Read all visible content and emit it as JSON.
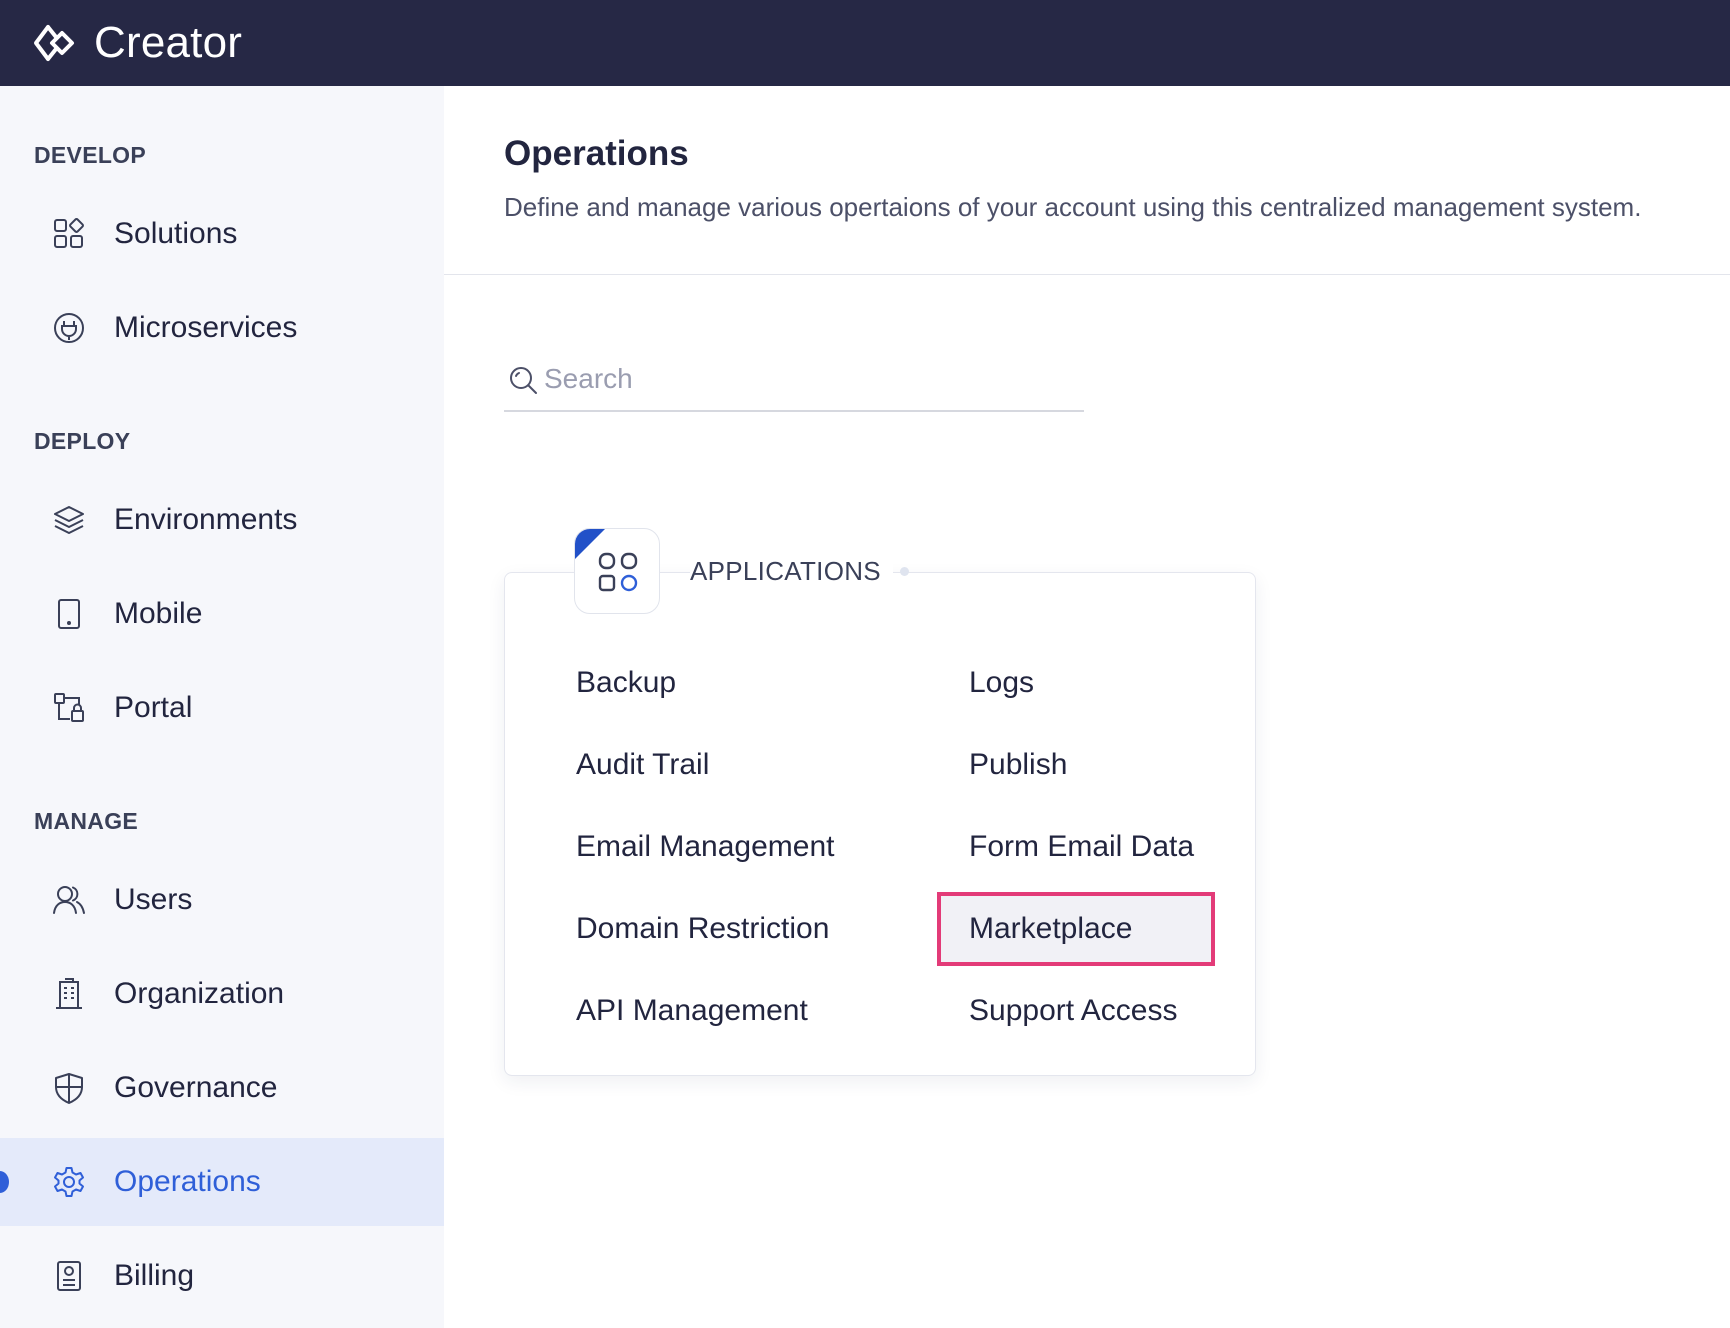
{
  "app": {
    "name": "Creator"
  },
  "sidebar": {
    "sections": [
      {
        "title": "DEVELOP"
      },
      {
        "title": "DEPLOY"
      },
      {
        "title": "MANAGE"
      }
    ],
    "items": [
      {
        "label": "Solutions",
        "icon": "solutions-icon"
      },
      {
        "label": "Microservices",
        "icon": "microservices-icon"
      },
      {
        "label": "Environments",
        "icon": "layers-icon"
      },
      {
        "label": "Mobile",
        "icon": "mobile-icon"
      },
      {
        "label": "Portal",
        "icon": "portal-icon"
      },
      {
        "label": "Users",
        "icon": "users-icon"
      },
      {
        "label": "Organization",
        "icon": "building-icon"
      },
      {
        "label": "Governance",
        "icon": "shield-icon"
      },
      {
        "label": "Operations",
        "icon": "gear-icon",
        "active": true
      },
      {
        "label": "Billing",
        "icon": "billing-icon"
      }
    ]
  },
  "main": {
    "title": "Operations",
    "description": "Define and manage various opertaions of your account using this centralized management system.",
    "search": {
      "placeholder": "Search",
      "value": ""
    },
    "card": {
      "title": "APPLICATIONS",
      "icon": "apps-icon",
      "left_links": [
        "Backup",
        "Audit Trail",
        "Email Management",
        "Domain Restriction",
        "API Management"
      ],
      "right_links": [
        "Logs",
        "Publish",
        "Form Email Data",
        "Marketplace",
        "Support Access"
      ],
      "highlighted": "Marketplace"
    }
  },
  "colors": {
    "topbar": "#262845",
    "accent": "#2f5fd8",
    "highlight_border": "#e33b78",
    "sidebar_bg": "#f6f7fb"
  }
}
